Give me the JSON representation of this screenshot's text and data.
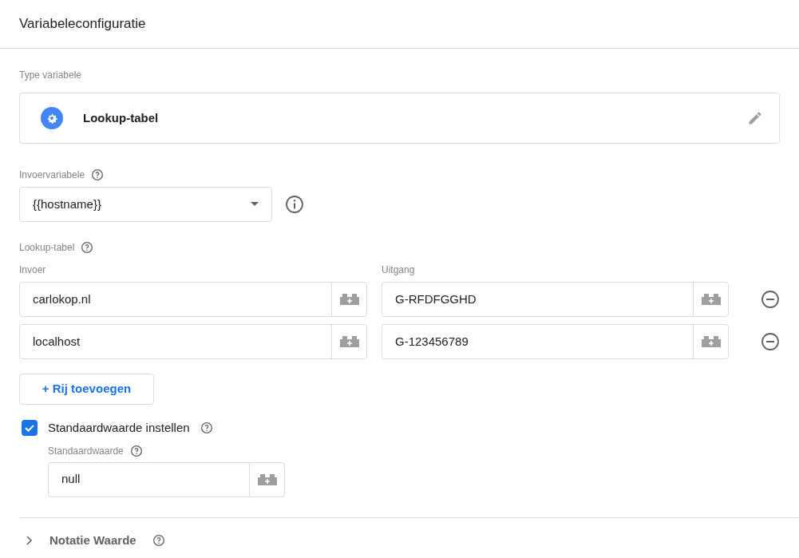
{
  "header": {
    "title": "Variabeleconfiguratie"
  },
  "variable_type": {
    "label": "Type variabele",
    "name": "Lookup-tabel"
  },
  "input_variable": {
    "label": "Invoervariabele",
    "value": "{{hostname}}"
  },
  "lookup_table": {
    "label": "Lookup-tabel",
    "columns": [
      "Invoer",
      "Uitgang"
    ],
    "rows": [
      {
        "input": "carlokop.nl",
        "output": "G-RFDFGGHD"
      },
      {
        "input": "localhost",
        "output": "G-123456789"
      }
    ],
    "add_button": "+ Rij toevoegen"
  },
  "default_value": {
    "label": "Standaardwaarde instellen",
    "checked": true,
    "field_label": "Standaardwaarde",
    "value": "null"
  },
  "format_section": {
    "label": "Notatie Waarde",
    "expanded": false
  }
}
